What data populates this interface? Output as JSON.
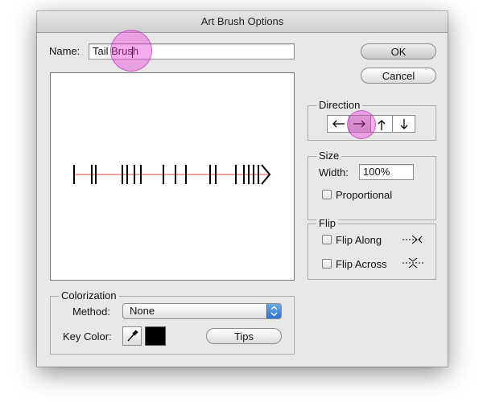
{
  "dialog": {
    "title": "Art Brush Options",
    "name_label": "Name:",
    "name_value": "Tail Brush",
    "ok_label": "OK",
    "cancel_label": "Cancel"
  },
  "direction": {
    "title": "Direction",
    "buttons": [
      {
        "icon": "arrow-left-icon",
        "glyph": "←",
        "selected": false
      },
      {
        "icon": "arrow-right-icon",
        "glyph": "→",
        "selected": true
      },
      {
        "icon": "arrow-up-icon",
        "glyph": "↑",
        "selected": false
      },
      {
        "icon": "arrow-down-icon",
        "glyph": "↓",
        "selected": false
      }
    ]
  },
  "size": {
    "title": "Size",
    "width_label": "Width:",
    "width_value": "100%",
    "proportional_label": "Proportional",
    "proportional_checked": false
  },
  "flip": {
    "title": "Flip",
    "along_label": "Flip Along",
    "along_checked": false,
    "across_label": "Flip Across",
    "across_checked": false
  },
  "colorization": {
    "title": "Colorization",
    "method_label": "Method:",
    "method_value": "None",
    "key_color_label": "Key Color:",
    "key_color": "#000000",
    "tips_label": "Tips"
  },
  "colors": {
    "dialog_bg": "#e8e8e8",
    "highlight": "#e73cdc",
    "guide_line": "#e04040",
    "brush_stroke": "#000000"
  }
}
